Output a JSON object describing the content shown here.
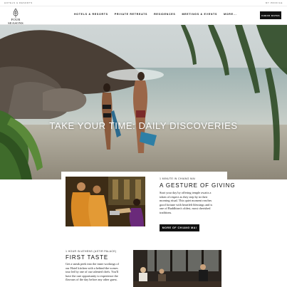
{
  "utility": {
    "left_text": "HOTELS & RESORTS",
    "right_text": "MY PROFILE"
  },
  "header": {
    "logo_text": "FOUR SEASONS",
    "nav": [
      "HOTELS & RESORTS",
      "PRIVATE RETREATS",
      "RESIDENCES",
      "MEETINGS & EVENTS",
      "MORE..."
    ],
    "book_label": "CHECK RATES"
  },
  "hero": {
    "title": "TAKE YOUR TIME: DAILY DISCOVERIES"
  },
  "feature": {
    "eyebrow": "1 MINUTE IN CHIANG MAI",
    "heading": "A GESTURE OF GIVING",
    "lines": [
      "Start your day by offering temple awaits a",
      "token of respect as they step by in their",
      "morning ritual. This quiet moment reaches",
      "good fortune with heartfelt blessings and is",
      "one of Buddhism's oldest, most cherished",
      "traditions."
    ],
    "button_label": "MORE OF CHIANG MAI"
  },
  "second": {
    "eyebrow": "1 HOUR IN ATHENS (ASTIR PALACE)",
    "heading": "FIRST TASTE",
    "lines": [
      "Get a sneak peek into the inner workings of",
      "our Hotel kitchen with a behind-the-scenes",
      "tour led by one of our talented chefs. You'll",
      "have the rare opportunity to experience the",
      "flavours of the day before any other guest."
    ]
  },
  "colors": {
    "primary": "#111111",
    "background": "#ffffff"
  },
  "icons": {
    "logo": "tree-icon"
  }
}
